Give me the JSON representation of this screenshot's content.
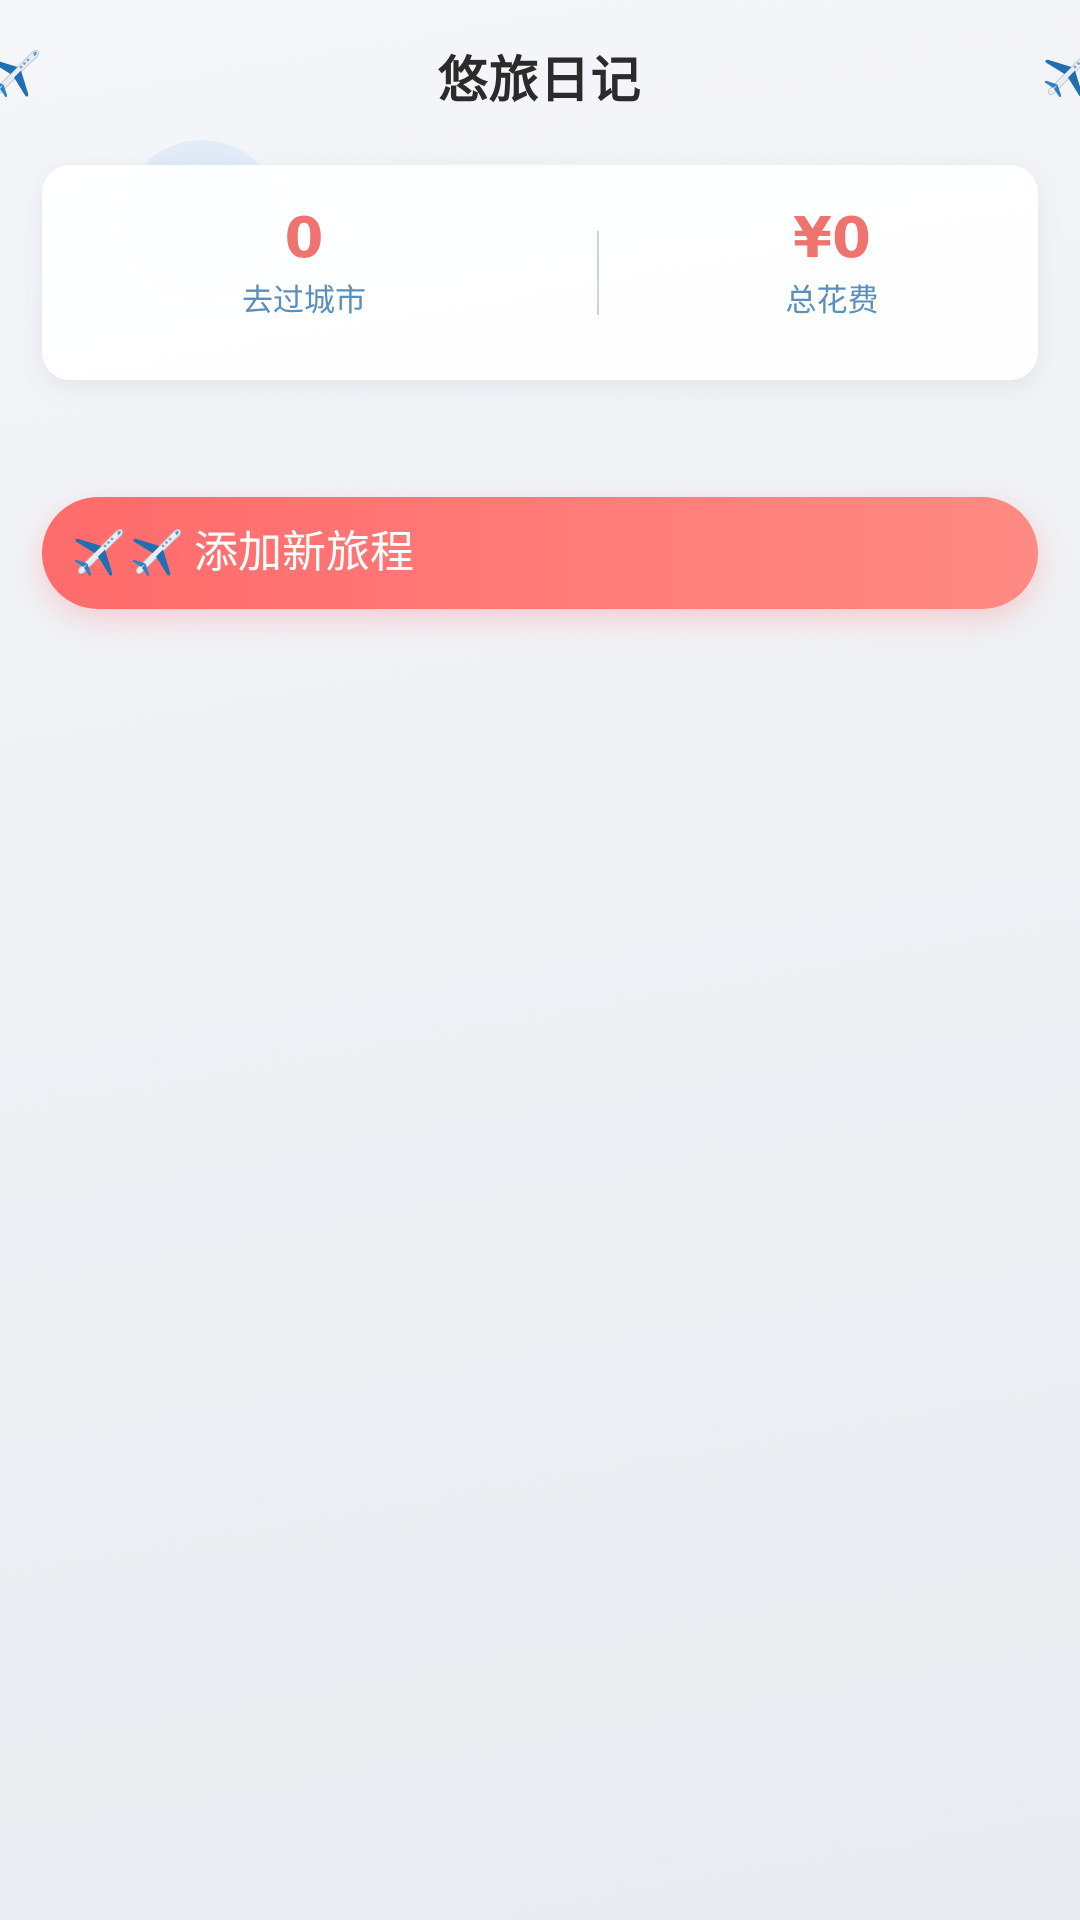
{
  "header": {
    "title": "悠旅日记",
    "left_icon": "airplane-icon",
    "right_icon": "airplane-icon"
  },
  "stats": {
    "cities_value": "0",
    "cities_label": "去过城市",
    "cost_value": "¥0",
    "cost_label": "总花费"
  },
  "add_button": {
    "icons": [
      "airplane-icon",
      "airplane-icon"
    ],
    "label": "添加新旅程"
  },
  "colors": {
    "accent": "#ff6b6b",
    "stat_value": "#ef7470",
    "stat_label": "#5a8fbd",
    "title": "#2b2b2b"
  }
}
